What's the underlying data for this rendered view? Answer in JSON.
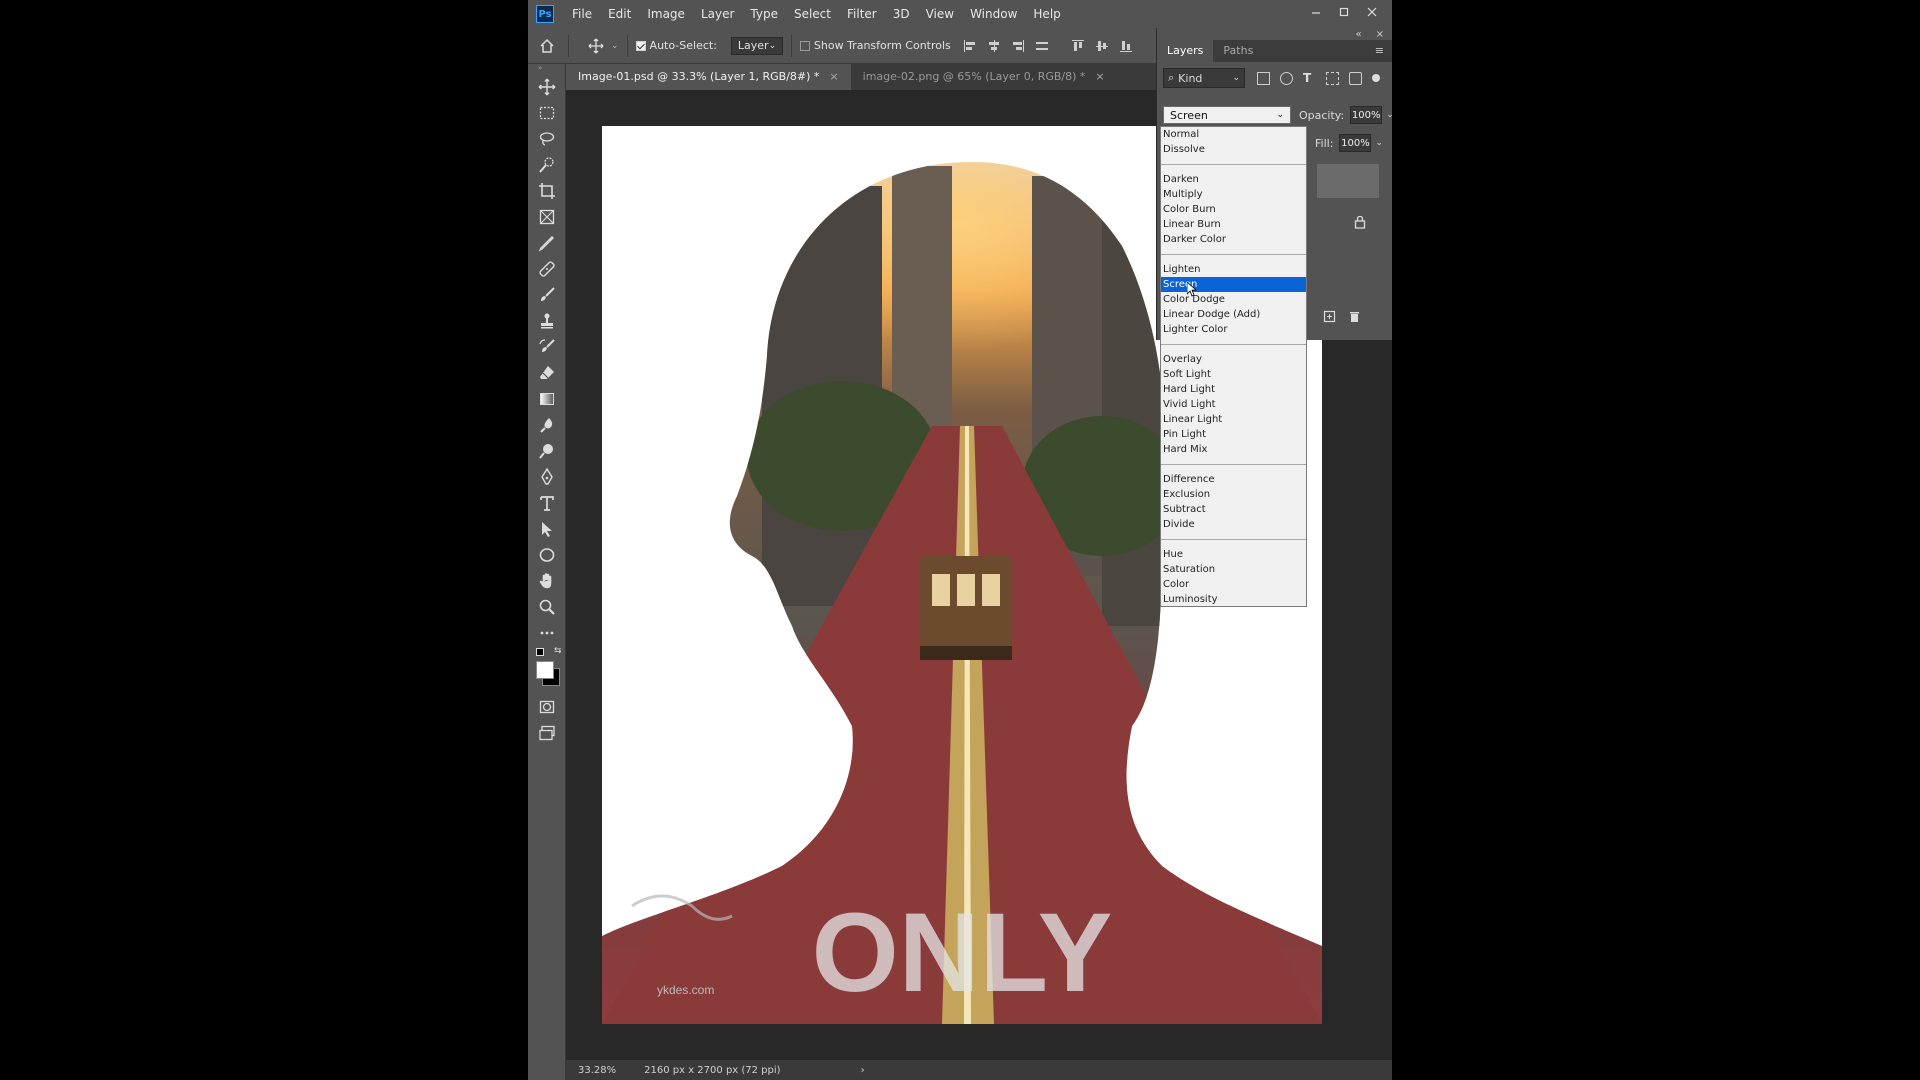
{
  "app": {
    "logo": "Ps",
    "menu": [
      "File",
      "Edit",
      "Image",
      "Layer",
      "Type",
      "Select",
      "Filter",
      "3D",
      "View",
      "Window",
      "Help"
    ],
    "window_controls": [
      "minimize-icon",
      "maximize-icon",
      "close-icon"
    ]
  },
  "options_bar": {
    "auto_select_label": "Auto-Select:",
    "auto_select_checked": true,
    "target_select": "Layer",
    "show_transform_label": "Show Transform Controls",
    "show_transform_checked": false
  },
  "documents": {
    "tabs": [
      {
        "label": "Image-01.psd @ 33.3% (Layer 1, RGB/8#) *",
        "active": true
      },
      {
        "label": "image-02.png @ 65% (Layer 0, RGB/8) *",
        "active": false
      }
    ]
  },
  "canvas": {
    "watermark_text": "ykdes.com",
    "road_text": "ONLY"
  },
  "status": {
    "zoom": "33.28%",
    "doc_info": "2160 px x 2700 px (72 ppi)"
  },
  "layers_panel": {
    "tabs": [
      "Layers",
      "Paths"
    ],
    "filter_kind": "Kind",
    "blend_mode": "Screen",
    "opacity_label": "Opacity:",
    "opacity_value": "100%",
    "fill_label": "Fill:",
    "fill_value": "100%"
  },
  "blend_dropdown": {
    "selected": "Screen",
    "groups": [
      [
        "Normal",
        "Dissolve"
      ],
      [
        "Darken",
        "Multiply",
        "Color Burn",
        "Linear Burn",
        "Darker Color"
      ],
      [
        "Lighten",
        "Screen",
        "Color Dodge",
        "Linear Dodge (Add)",
        "Lighter Color"
      ],
      [
        "Overlay",
        "Soft Light",
        "Hard Light",
        "Vivid Light",
        "Linear Light",
        "Pin Light",
        "Hard Mix"
      ],
      [
        "Difference",
        "Exclusion",
        "Subtract",
        "Divide"
      ],
      [
        "Hue",
        "Saturation",
        "Color",
        "Luminosity"
      ]
    ]
  },
  "colors": {
    "ui_bg": "#535353",
    "dark_bg": "#3a3a3a",
    "canvas_bg": "#282828",
    "selection": "#0a64d6",
    "ps_blue": "#31a8ff"
  }
}
